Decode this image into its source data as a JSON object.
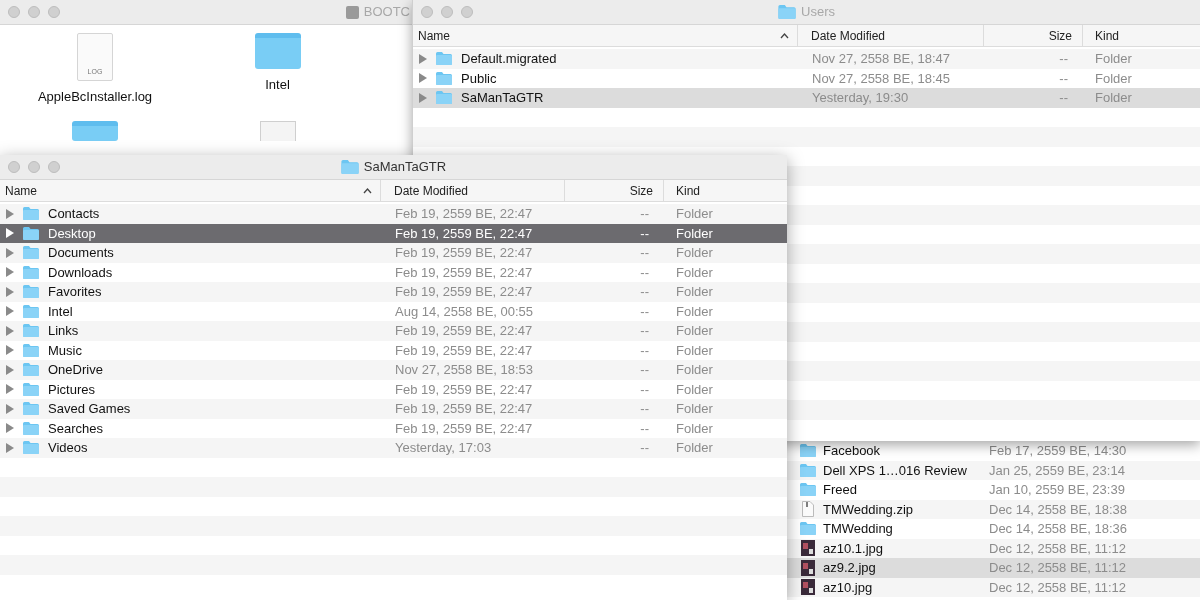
{
  "volume_window": {
    "title": "BOOTC",
    "icons": [
      {
        "label": "AppleBcInstaller.log",
        "kind": "log",
        "badge": "LOG"
      },
      {
        "label": "Intel",
        "kind": "folder"
      },
      {
        "kind": "folder"
      },
      {
        "kind": "document"
      }
    ]
  },
  "users_window": {
    "title": "Users",
    "columns": [
      "Name",
      "Date Modified",
      "Size",
      "Kind"
    ],
    "rows": [
      {
        "name": "Default.migrated",
        "date": "Nov 27, 2558 BE, 18:47",
        "size": "--",
        "kind": "Folder",
        "selected": false
      },
      {
        "name": "Public",
        "date": "Nov 27, 2558 BE, 18:45",
        "size": "--",
        "kind": "Folder",
        "selected": false
      },
      {
        "name": "SaManTaGTR",
        "date": "Yesterday, 19:30",
        "size": "--",
        "kind": "Folder",
        "selected": true
      }
    ]
  },
  "back_window": {
    "rows": [
      {
        "name": "Facebook",
        "date": "Feb 17, 2559 BE, 14:30",
        "kind": "folder",
        "selected": false
      },
      {
        "name": "Dell XPS 1…016 Review",
        "date": "Jan 25, 2559 BE, 23:14",
        "kind": "folder",
        "selected": false
      },
      {
        "name": "Freed",
        "date": "Jan 10, 2559 BE, 23:39",
        "kind": "folder",
        "selected": false
      },
      {
        "name": "TMWedding.zip",
        "date": "Dec 14, 2558 BE, 18:38",
        "kind": "zip",
        "selected": false
      },
      {
        "name": "TMWedding",
        "date": "Dec 14, 2558 BE, 18:36",
        "kind": "folder",
        "selected": false
      },
      {
        "name": "az10.1.jpg",
        "date": "Dec 12, 2558 BE, 11:12",
        "kind": "image",
        "selected": false
      },
      {
        "name": "az9.2.jpg",
        "date": "Dec 12, 2558 BE, 11:12",
        "kind": "image",
        "selected": true
      },
      {
        "name": "az10.jpg",
        "date": "Dec 12, 2558 BE, 11:12",
        "kind": "image",
        "selected": false
      }
    ]
  },
  "home_window": {
    "title": "SaManTaGTR",
    "columns": [
      "Name",
      "Date Modified",
      "Size",
      "Kind"
    ],
    "rows": [
      {
        "name": "Contacts",
        "date": "Feb 19, 2559 BE, 22:47",
        "size": "--",
        "kind": "Folder",
        "selected": false
      },
      {
        "name": "Desktop",
        "date": "Feb 19, 2559 BE, 22:47",
        "size": "--",
        "kind": "Folder",
        "selected": true
      },
      {
        "name": "Documents",
        "date": "Feb 19, 2559 BE, 22:47",
        "size": "--",
        "kind": "Folder",
        "selected": false
      },
      {
        "name": "Downloads",
        "date": "Feb 19, 2559 BE, 22:47",
        "size": "--",
        "kind": "Folder",
        "selected": false
      },
      {
        "name": "Favorites",
        "date": "Feb 19, 2559 BE, 22:47",
        "size": "--",
        "kind": "Folder",
        "selected": false
      },
      {
        "name": "Intel",
        "date": "Aug 14, 2558 BE, 00:55",
        "size": "--",
        "kind": "Folder",
        "selected": false
      },
      {
        "name": "Links",
        "date": "Feb 19, 2559 BE, 22:47",
        "size": "--",
        "kind": "Folder",
        "selected": false
      },
      {
        "name": "Music",
        "date": "Feb 19, 2559 BE, 22:47",
        "size": "--",
        "kind": "Folder",
        "selected": false
      },
      {
        "name": "OneDrive",
        "date": "Nov 27, 2558 BE, 18:53",
        "size": "--",
        "kind": "Folder",
        "selected": false
      },
      {
        "name": "Pictures",
        "date": "Feb 19, 2559 BE, 22:47",
        "size": "--",
        "kind": "Folder",
        "selected": false
      },
      {
        "name": "Saved Games",
        "date": "Feb 19, 2559 BE, 22:47",
        "size": "--",
        "kind": "Folder",
        "selected": false
      },
      {
        "name": "Searches",
        "date": "Feb 19, 2559 BE, 22:47",
        "size": "--",
        "kind": "Folder",
        "selected": false
      },
      {
        "name": "Videos",
        "date": "Yesterday, 17:03",
        "size": "--",
        "kind": "Folder",
        "selected": false
      }
    ]
  }
}
